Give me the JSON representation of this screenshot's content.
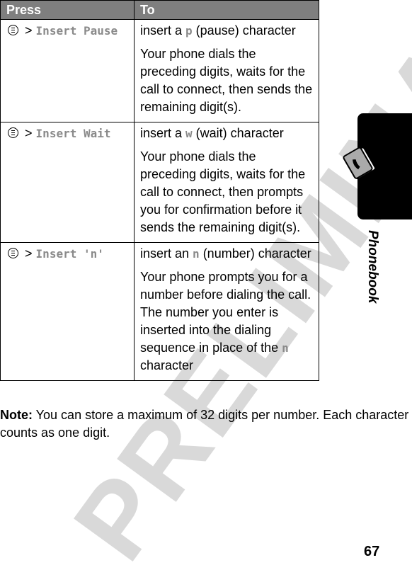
{
  "watermark": "PRELIMINARY",
  "table": {
    "headers": [
      "Press",
      "To"
    ],
    "rows": [
      {
        "key_prefix": ">",
        "key_item": "Insert Pause",
        "desc_pre": "insert a ",
        "desc_char": "p",
        "desc_post": " (pause) character",
        "detail": "Your phone dials the preceding digits, waits for the call to connect, then sends the remaining digit(s)."
      },
      {
        "key_prefix": ">",
        "key_item": "Insert Wait",
        "desc_pre": "insert a ",
        "desc_char": "w",
        "desc_post": " (wait) character",
        "detail": "Your phone dials the preceding digits, waits for the call to connect, then prompts you for confirmation before it sends the remaining digit(s)."
      },
      {
        "key_prefix": ">",
        "key_item": "Insert 'n'",
        "desc_pre": "insert an ",
        "desc_char": "n",
        "desc_post": " (number) character",
        "detail_pre": "Your phone prompts you for a number before dialing the call. The number you enter is inserted into the dialing sequence in place of the ",
        "detail_char": "n",
        "detail_post": " character"
      }
    ]
  },
  "note": {
    "label": "Note:",
    "text": " You can store a maximum of 32 digits per number. Each character counts as one digit."
  },
  "sidebar": {
    "section": "Phonebook",
    "icon": "phonebook-icon"
  },
  "page_number": "67"
}
